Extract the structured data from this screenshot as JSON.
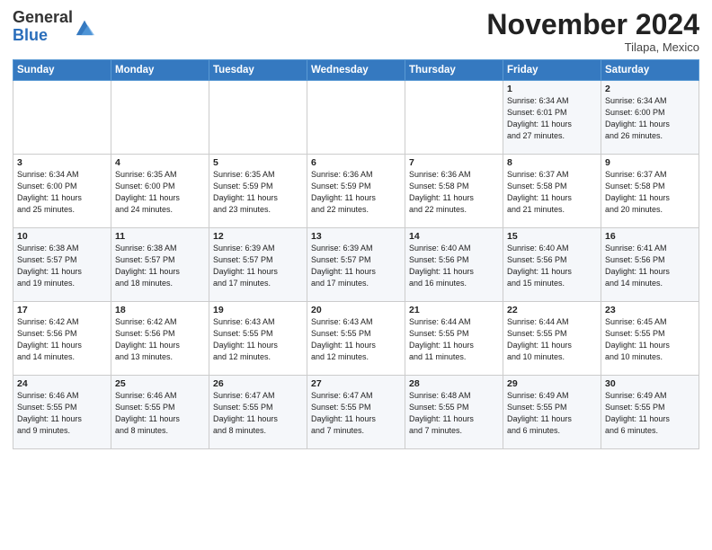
{
  "header": {
    "logo_general": "General",
    "logo_blue": "Blue",
    "month": "November 2024",
    "location": "Tilapa, Mexico"
  },
  "days_of_week": [
    "Sunday",
    "Monday",
    "Tuesday",
    "Wednesday",
    "Thursday",
    "Friday",
    "Saturday"
  ],
  "weeks": [
    [
      {
        "day": "",
        "info": ""
      },
      {
        "day": "",
        "info": ""
      },
      {
        "day": "",
        "info": ""
      },
      {
        "day": "",
        "info": ""
      },
      {
        "day": "",
        "info": ""
      },
      {
        "day": "1",
        "info": "Sunrise: 6:34 AM\nSunset: 6:01 PM\nDaylight: 11 hours\nand 27 minutes."
      },
      {
        "day": "2",
        "info": "Sunrise: 6:34 AM\nSunset: 6:00 PM\nDaylight: 11 hours\nand 26 minutes."
      }
    ],
    [
      {
        "day": "3",
        "info": "Sunrise: 6:34 AM\nSunset: 6:00 PM\nDaylight: 11 hours\nand 25 minutes."
      },
      {
        "day": "4",
        "info": "Sunrise: 6:35 AM\nSunset: 6:00 PM\nDaylight: 11 hours\nand 24 minutes."
      },
      {
        "day": "5",
        "info": "Sunrise: 6:35 AM\nSunset: 5:59 PM\nDaylight: 11 hours\nand 23 minutes."
      },
      {
        "day": "6",
        "info": "Sunrise: 6:36 AM\nSunset: 5:59 PM\nDaylight: 11 hours\nand 22 minutes."
      },
      {
        "day": "7",
        "info": "Sunrise: 6:36 AM\nSunset: 5:58 PM\nDaylight: 11 hours\nand 22 minutes."
      },
      {
        "day": "8",
        "info": "Sunrise: 6:37 AM\nSunset: 5:58 PM\nDaylight: 11 hours\nand 21 minutes."
      },
      {
        "day": "9",
        "info": "Sunrise: 6:37 AM\nSunset: 5:58 PM\nDaylight: 11 hours\nand 20 minutes."
      }
    ],
    [
      {
        "day": "10",
        "info": "Sunrise: 6:38 AM\nSunset: 5:57 PM\nDaylight: 11 hours\nand 19 minutes."
      },
      {
        "day": "11",
        "info": "Sunrise: 6:38 AM\nSunset: 5:57 PM\nDaylight: 11 hours\nand 18 minutes."
      },
      {
        "day": "12",
        "info": "Sunrise: 6:39 AM\nSunset: 5:57 PM\nDaylight: 11 hours\nand 17 minutes."
      },
      {
        "day": "13",
        "info": "Sunrise: 6:39 AM\nSunset: 5:57 PM\nDaylight: 11 hours\nand 17 minutes."
      },
      {
        "day": "14",
        "info": "Sunrise: 6:40 AM\nSunset: 5:56 PM\nDaylight: 11 hours\nand 16 minutes."
      },
      {
        "day": "15",
        "info": "Sunrise: 6:40 AM\nSunset: 5:56 PM\nDaylight: 11 hours\nand 15 minutes."
      },
      {
        "day": "16",
        "info": "Sunrise: 6:41 AM\nSunset: 5:56 PM\nDaylight: 11 hours\nand 14 minutes."
      }
    ],
    [
      {
        "day": "17",
        "info": "Sunrise: 6:42 AM\nSunset: 5:56 PM\nDaylight: 11 hours\nand 14 minutes."
      },
      {
        "day": "18",
        "info": "Sunrise: 6:42 AM\nSunset: 5:56 PM\nDaylight: 11 hours\nand 13 minutes."
      },
      {
        "day": "19",
        "info": "Sunrise: 6:43 AM\nSunset: 5:55 PM\nDaylight: 11 hours\nand 12 minutes."
      },
      {
        "day": "20",
        "info": "Sunrise: 6:43 AM\nSunset: 5:55 PM\nDaylight: 11 hours\nand 12 minutes."
      },
      {
        "day": "21",
        "info": "Sunrise: 6:44 AM\nSunset: 5:55 PM\nDaylight: 11 hours\nand 11 minutes."
      },
      {
        "day": "22",
        "info": "Sunrise: 6:44 AM\nSunset: 5:55 PM\nDaylight: 11 hours\nand 10 minutes."
      },
      {
        "day": "23",
        "info": "Sunrise: 6:45 AM\nSunset: 5:55 PM\nDaylight: 11 hours\nand 10 minutes."
      }
    ],
    [
      {
        "day": "24",
        "info": "Sunrise: 6:46 AM\nSunset: 5:55 PM\nDaylight: 11 hours\nand 9 minutes."
      },
      {
        "day": "25",
        "info": "Sunrise: 6:46 AM\nSunset: 5:55 PM\nDaylight: 11 hours\nand 8 minutes."
      },
      {
        "day": "26",
        "info": "Sunrise: 6:47 AM\nSunset: 5:55 PM\nDaylight: 11 hours\nand 8 minutes."
      },
      {
        "day": "27",
        "info": "Sunrise: 6:47 AM\nSunset: 5:55 PM\nDaylight: 11 hours\nand 7 minutes."
      },
      {
        "day": "28",
        "info": "Sunrise: 6:48 AM\nSunset: 5:55 PM\nDaylight: 11 hours\nand 7 minutes."
      },
      {
        "day": "29",
        "info": "Sunrise: 6:49 AM\nSunset: 5:55 PM\nDaylight: 11 hours\nand 6 minutes."
      },
      {
        "day": "30",
        "info": "Sunrise: 6:49 AM\nSunset: 5:55 PM\nDaylight: 11 hours\nand 6 minutes."
      }
    ]
  ]
}
